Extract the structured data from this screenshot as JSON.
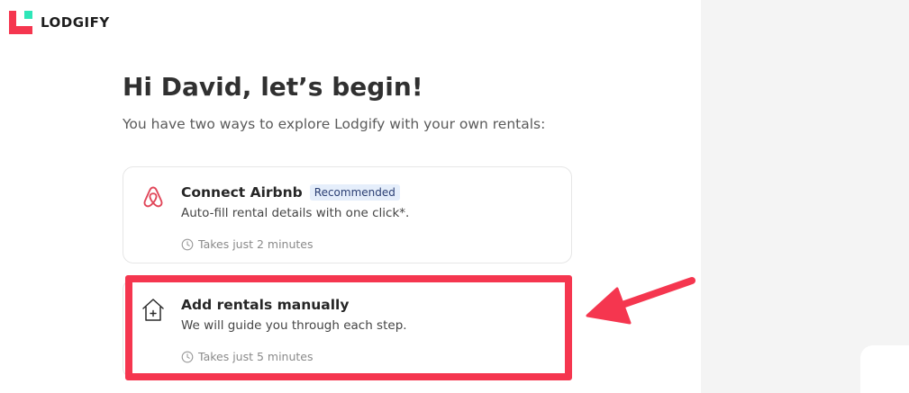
{
  "brand": {
    "name": "LODGIFY"
  },
  "greeting": {
    "title": "Hi David, let’s begin!",
    "subtitle": "You have two ways to explore Lodgify with your own rentals:"
  },
  "options": [
    {
      "icon": "airbnb-icon",
      "title": "Connect Airbnb",
      "badge": "Recommended",
      "description": "Auto-fill rental details with one click*.",
      "time": "Takes just 2 minutes"
    },
    {
      "icon": "house-plus-icon",
      "title": "Add rentals manually",
      "description": "We will guide you through each step.",
      "time": "Takes just 5 minutes"
    }
  ],
  "colors": {
    "brand_red": "#f5364f",
    "brand_teal": "#2ee6b8",
    "airbnb_red": "#e1475a",
    "badge_bg": "#e5eefb",
    "annotation": "#f5364f"
  }
}
